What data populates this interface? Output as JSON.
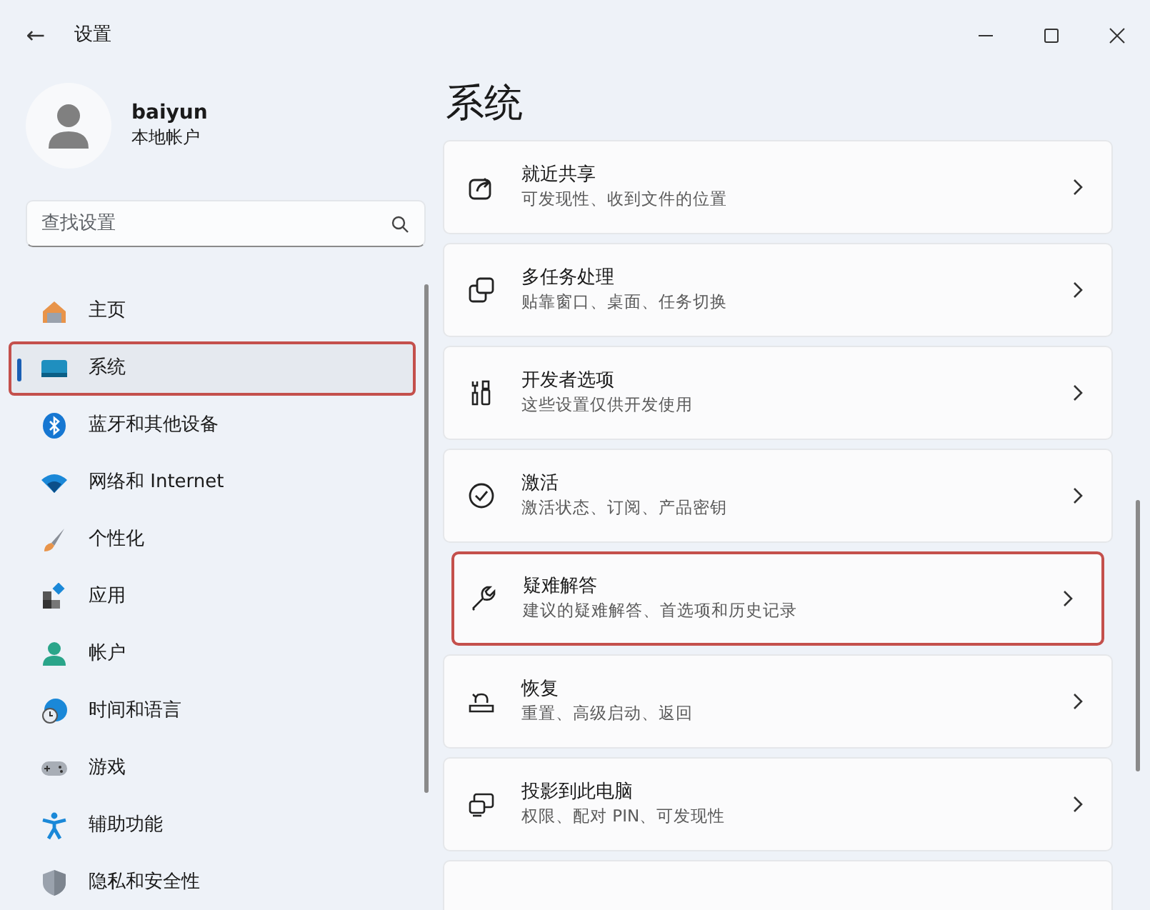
{
  "window": {
    "title": "设置",
    "back": "←"
  },
  "profile": {
    "name": "baiyun",
    "account": "本地帐户"
  },
  "search": {
    "placeholder": "查找设置"
  },
  "sidebar": {
    "items": [
      {
        "label": "主页",
        "selected": false,
        "highlighted": false
      },
      {
        "label": "系统",
        "selected": true,
        "highlighted": true
      },
      {
        "label": "蓝牙和其他设备",
        "selected": false,
        "highlighted": false
      },
      {
        "label": "网络和 Internet",
        "selected": false,
        "highlighted": false
      },
      {
        "label": "个性化",
        "selected": false,
        "highlighted": false
      },
      {
        "label": "应用",
        "selected": false,
        "highlighted": false
      },
      {
        "label": "帐户",
        "selected": false,
        "highlighted": false
      },
      {
        "label": "时间和语言",
        "selected": false,
        "highlighted": false
      },
      {
        "label": "游戏",
        "selected": false,
        "highlighted": false
      },
      {
        "label": "辅助功能",
        "selected": false,
        "highlighted": false
      },
      {
        "label": "隐私和安全性",
        "selected": false,
        "highlighted": false
      }
    ]
  },
  "page_title": "系统",
  "settings": [
    {
      "title": "就近共享",
      "description": "可发现性、收到文件的位置",
      "highlighted": false
    },
    {
      "title": "多任务处理",
      "description": "贴靠窗口、桌面、任务切换",
      "highlighted": false
    },
    {
      "title": "开发者选项",
      "description": "这些设置仅供开发使用",
      "highlighted": false
    },
    {
      "title": "激活",
      "description": "激活状态、订阅、产品密钥",
      "highlighted": false
    },
    {
      "title": "疑难解答",
      "description": "建议的疑难解答、首选项和历史记录",
      "highlighted": true
    },
    {
      "title": "恢复",
      "description": "重置、高级启动、返回",
      "highlighted": false
    },
    {
      "title": "投影到此电脑",
      "description": "权限、配对 PIN、可发现性",
      "highlighted": false
    },
    {
      "kind": "partial"
    }
  ]
}
